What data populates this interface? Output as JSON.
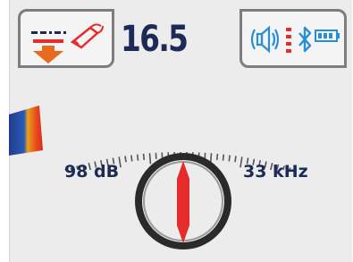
{
  "depth": {
    "value": "16.5"
  },
  "readouts": {
    "signal_strength": "98 dB",
    "frequency": "33 kHz"
  },
  "mode": {
    "icon": "depth-mode-icon",
    "direction": "down-arrow-icon",
    "probe": "sonde-icon"
  },
  "status": {
    "icons": [
      "speaker-volume-icon",
      "signal-level-icon",
      "bluetooth-icon",
      "battery-icon"
    ],
    "battery_level": 1.0
  },
  "signal_meter": {
    "level": 0.16
  },
  "compass": {
    "needle_heading_deg": 0
  },
  "colors": {
    "text": "#1c2a55",
    "accent_red": "#e52b2b",
    "bluetooth_blue": "#2a8ed6",
    "frame_grey": "#7d7d7d",
    "background": "#ececec"
  }
}
